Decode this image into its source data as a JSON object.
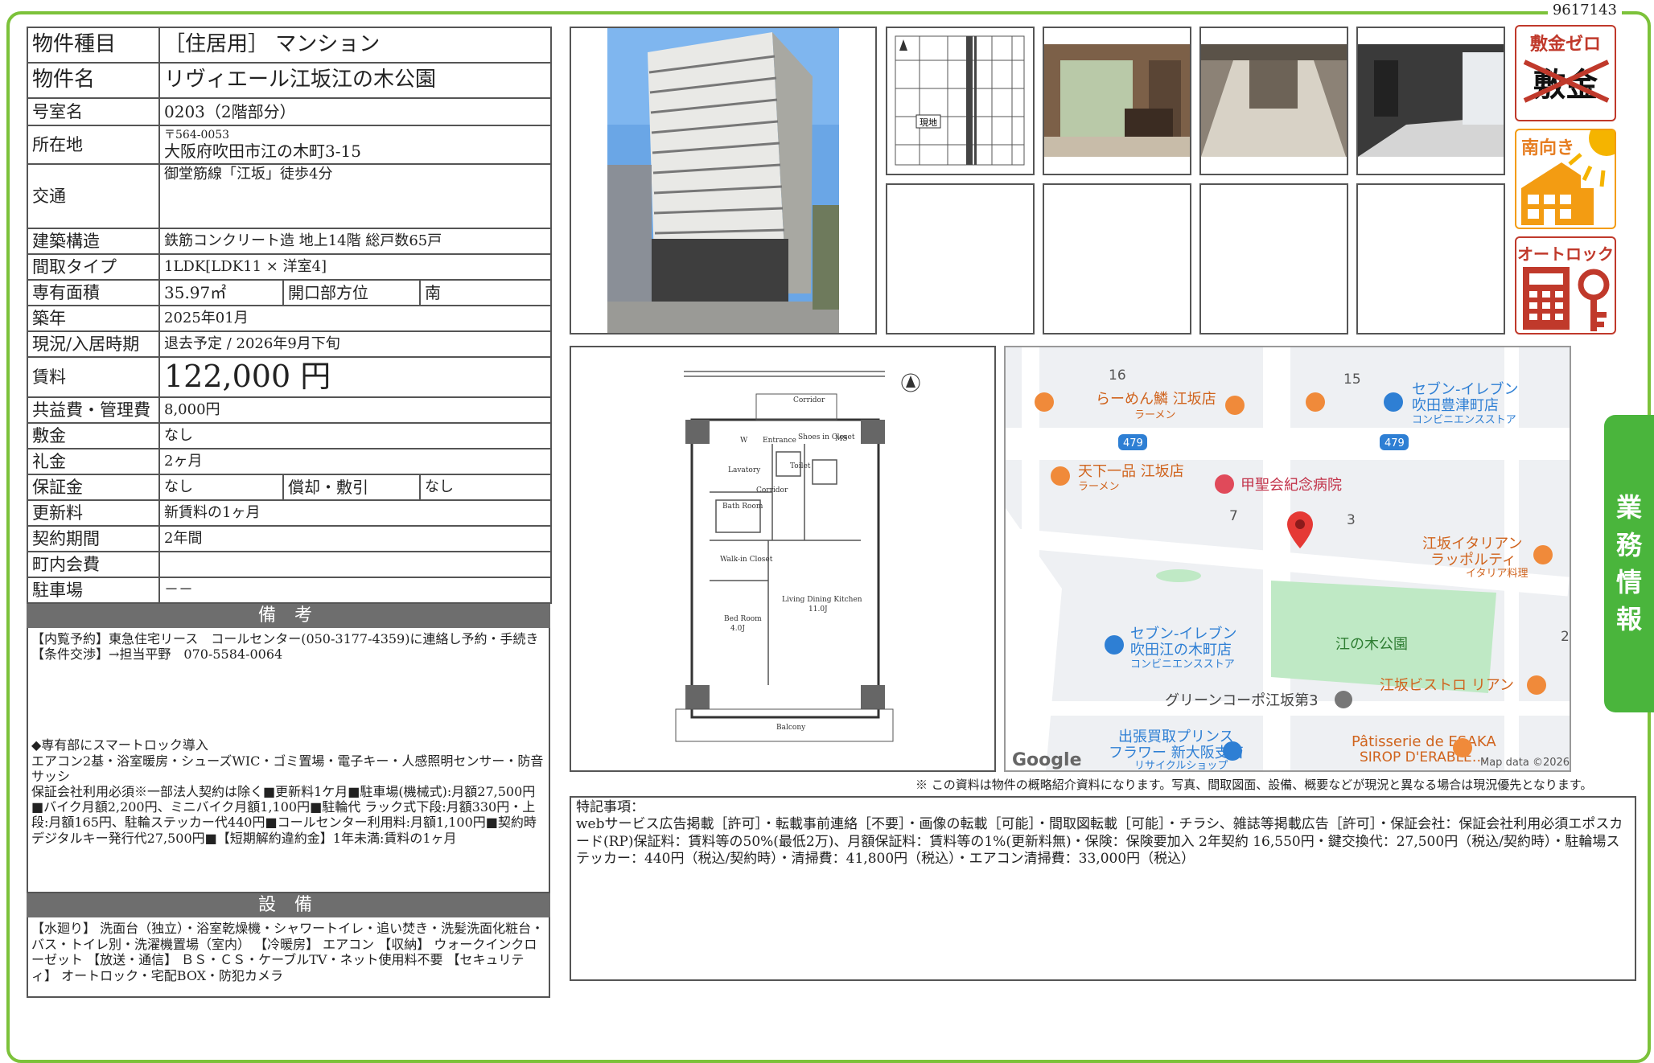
{
  "doc_id": "9617143",
  "property": {
    "rows": [
      {
        "label": "物件種目",
        "value": "［住居用］ マンション"
      },
      {
        "label": "物件名",
        "value": "リヴィエール江坂江の木公園"
      },
      {
        "label": "号室名",
        "value": "0203（2階部分）"
      },
      {
        "label": "所在地",
        "postal": "〒564-0053",
        "value": "大阪府吹田市江の木町3-15"
      },
      {
        "label": "交通",
        "value": "御堂筋線「江坂」徒歩4分"
      },
      {
        "label": "建築構造",
        "value": "鉄筋コンクリート造 地上14階 総戸数65戸"
      },
      {
        "label": "間取タイプ",
        "value": "1LDK[LDK11 × 洋室4]"
      },
      {
        "label": "専有面積",
        "value": "35.97㎡",
        "label2": "開口部方位",
        "value2": "南"
      },
      {
        "label": "築年",
        "value": "2025年01月"
      },
      {
        "label": "現況/入居時期",
        "value": "退去予定 / 2026年9月下旬"
      },
      {
        "label": "賃料",
        "value": "122,000 円"
      },
      {
        "label": "共益費・管理費",
        "value": "8,000円"
      },
      {
        "label": "敷金",
        "value": "なし"
      },
      {
        "label": "礼金",
        "value": "2ヶ月"
      },
      {
        "label": "保証金",
        "value": "なし",
        "label2": "償却・敷引",
        "value2": "なし"
      },
      {
        "label": "更新料",
        "value": "新賃料の1ヶ月"
      },
      {
        "label": "契約期間",
        "value": "2年間"
      },
      {
        "label": "町内会費",
        "value": ""
      },
      {
        "label": "駐車場",
        "value": "－－"
      }
    ]
  },
  "remarks": {
    "title": "備 考",
    "lines": [
      "【内覧予約】東急住宅リース　コールセンター(050-3177-4359)に連絡し予約・手続き",
      "【条件交渉】→担当平野　070-5584-0064",
      "",
      "",
      "",
      "",
      "◆専有部にスマートロック導入",
      "エアコン2基・浴室暖房・シューズWIC・ゴミ置場・電子キー・人感照明センサー・防音サッシ",
      "保証会社利用必須※一部法人契約は除く■更新料1ケ月■駐車場(機械式):月額27,500円■バイク月額2,200円、ミニバイク月額1,100円■駐輪代 ラック式下段:月額330円・上段:月額165円、駐輪ステッカー代440円■コールセンター利用料:月額1,100円■契約時デジタルキー発行代27,500円■【短期解約違約金】1年未満:賃料の1ヶ月"
    ]
  },
  "equipment": {
    "title": "設 備",
    "text": "【水廻り】 洗面台（独立）・浴室乾燥機・シャワートイレ・追い焚き・洗髪洗面化粧台・バス・トイレ別・洗濯機置場（室内） 【冷暖房】 エアコン 【収納】 ウォークインクローゼット 【放送・通信】 ＢＳ・ＣＳ・ケーブルTV・ネット使用料不要 【セキュリティ】 オートロック・宅配BOX・防犯カメラ"
  },
  "badges": [
    {
      "name": "shikikin-zero",
      "top": "敷金ゼロ",
      "main": "敷金"
    },
    {
      "name": "south-facing",
      "top": "南向き"
    },
    {
      "name": "auto-lock",
      "top": "オートロック"
    }
  ],
  "map_labels": {
    "site": "現地",
    "block16": "16",
    "block15": "15",
    "block7": "7",
    "block3": "3",
    "block2": "2",
    "route1": "479",
    "route2": "479",
    "ramen": "らーめん鱗 江坂店",
    "ramen_sub": "ラーメン",
    "tenka": "天下一品 江坂店",
    "tenka_sub": "ラーメン",
    "seven1": "セブン-イレブン",
    "seven1b": "吹田豊津町店",
    "seven1_sub": "コンビニエンスストア",
    "hospital": "甲聖会紀念病院",
    "italian": "江坂イタリアン",
    "italian2": "ラッポルティ",
    "italian_sub": "イタリア料理",
    "seven2": "セブン-イレブン",
    "seven2b": "吹田江の木町店",
    "seven2_sub": "コンビニエンスストア",
    "park": "江の木公園",
    "bistro": "江坂ビストロ リアン",
    "green": "グリーンコーポ江坂第3",
    "prince": "出張買取プリンス",
    "prince2": "フラワー 新大阪支店",
    "prince_sub": "リサイクルショップ",
    "patisserie": "Pâtisserie de ESAKA",
    "patisserie2": "SIROP D'ERABLE…",
    "google": "Google",
    "mapdata": "Map data ©2026"
  },
  "floorplan": {
    "corridor": "Corridor",
    "entrance": "Entrance",
    "shoes": "Shoes in Closet",
    "wc": "W",
    "ms": "MS",
    "lavatory": "Lavatory",
    "toilet": "Toilet",
    "bath": "Bath Room",
    "corridor2": "Corridor",
    "walkin": "Walk-in Closet",
    "ldk": "Living Dining Kitchen",
    "ldk_size": "11.0J",
    "bed": "Bed Room",
    "bed_size": "4.0J",
    "balcony": "Balcony"
  },
  "note": "※ この資料は物件の概略紹介資料になります。写真、間取図面、設備、概要などが現況と異なる場合は現況優先となります。",
  "special": {
    "title": "特記事項：",
    "text": "webサービス広告掲載［許可］・転載事前連絡［不要］・画像の転載［可能］・間取図転載［可能］・チラシ、雑誌等掲載広告［許可］・保証会社：保証会社利用必須エポスカード(RP)保証料：賃料等の50%(最低2万)、月額保証料：賃料等の1%(更新料無)・保険：保険要加入 2年契約 16,550円・鍵交換代：27,500円（税込/契約時）・駐輪場ステッカー：440円（税込/契約時）・清掃費：41,800円（税込）・エアコン清掃費：33,000円（税込）"
  },
  "side_tab": [
    "業",
    "務",
    "情",
    "報"
  ],
  "colors": {
    "accent_green": "#4ab53c",
    "badge_red": "#c0392b",
    "badge_orange": "#f39c12",
    "header_gray": "#6e6e6e"
  }
}
